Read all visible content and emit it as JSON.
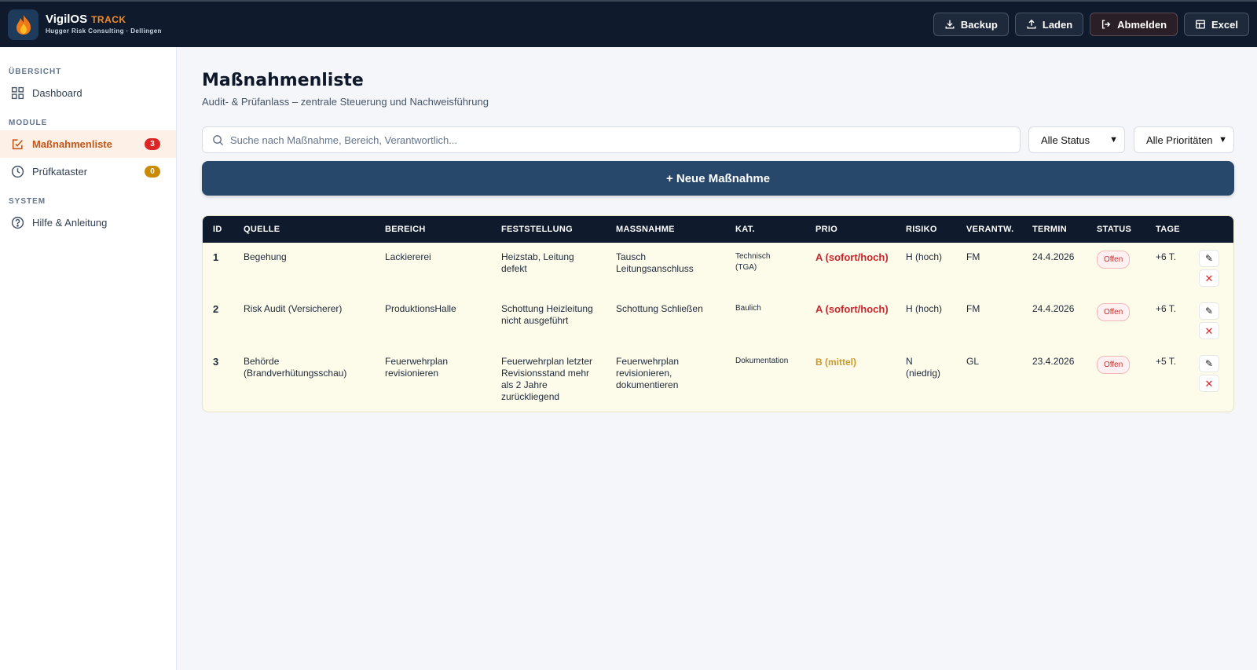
{
  "app": {
    "name": "VigilOS",
    "name_accent": "TRACK",
    "subtitle": "Hugger Risk Consulting · Dellingen"
  },
  "toolbar": {
    "backup": "Backup",
    "laden": "Laden",
    "abmelden": "Abmelden",
    "excel": "Excel"
  },
  "sidebar": {
    "sections": [
      "ÜBERSICHT",
      "MODULE",
      "SYSTEM"
    ],
    "items": [
      {
        "label": "Dashboard"
      },
      {
        "label": "Maßnahmenliste",
        "badge": "3"
      },
      {
        "label": "Prüfkataster",
        "badge": "0"
      },
      {
        "label": "Hilfe & Anleitung"
      }
    ]
  },
  "page": {
    "title": "Maßnahmenliste",
    "subtitle": "Audit- & Prüfanlass – zentrale Steuerung und Nachweisführung",
    "search_placeholder": "Suche nach Maßnahme, Bereich, Verantwortlich...",
    "status_filter": "Alle Status",
    "prio_filter": "Alle Prioritäten",
    "new_button": "+ Neue Maßnahme"
  },
  "table": {
    "headers": [
      "ID",
      "QUELLE",
      "BEREICH",
      "FESTSTELLUNG",
      "MASSNAHME",
      "KAT.",
      "PRIO",
      "RISIKO",
      "VERANTW.",
      "TERMIN",
      "STATUS",
      "TAGE"
    ],
    "rows": [
      {
        "id": "1",
        "quelle": "Begehung",
        "bereich": "Lackiererei",
        "feststellung": "Heizstab, Leitung defekt",
        "massnahme": "Tausch Leitungsanschluss",
        "kat": "Technisch (TGA)",
        "prio": "A (sofort/hoch)",
        "risiko": "H (hoch)",
        "verantw": "FM",
        "termin": "24.4.2026",
        "status": "Offen",
        "tage": "+6 T."
      },
      {
        "id": "2",
        "quelle": "Risk Audit (Versicherer)",
        "bereich": "ProduktionsHalle",
        "feststellung": "Schottung Heizleitung nicht ausgeführt",
        "massnahme": "Schottung Schließen",
        "kat": "Baulich",
        "prio": "A (sofort/hoch)",
        "risiko": "H (hoch)",
        "verantw": "FM",
        "termin": "24.4.2026",
        "status": "Offen",
        "tage": "+6 T."
      },
      {
        "id": "3",
        "quelle": "Behörde (Brandverhütungsschau)",
        "bereich": "Feuerwehrplan revisionieren",
        "feststellung": "Feuerwehrplan letzter Revisionsstand mehr als 2 Jahre zurückliegend",
        "massnahme": "Feuerwehrplan revisionieren, dokumentieren",
        "kat": "Dokumentation",
        "prio": "B (mittel)",
        "risiko": "N (niedrig)",
        "verantw": "GL",
        "termin": "23.4.2026",
        "status": "Offen",
        "tage": "+5 T."
      }
    ]
  },
  "colors": {
    "topbar": "#0f1b2d",
    "accent": "#f28c28",
    "primary_button": "#27476b",
    "prio_a": "#c8282d",
    "prio_b": "#c99a2e",
    "row_bg": "#fdfbe9"
  }
}
